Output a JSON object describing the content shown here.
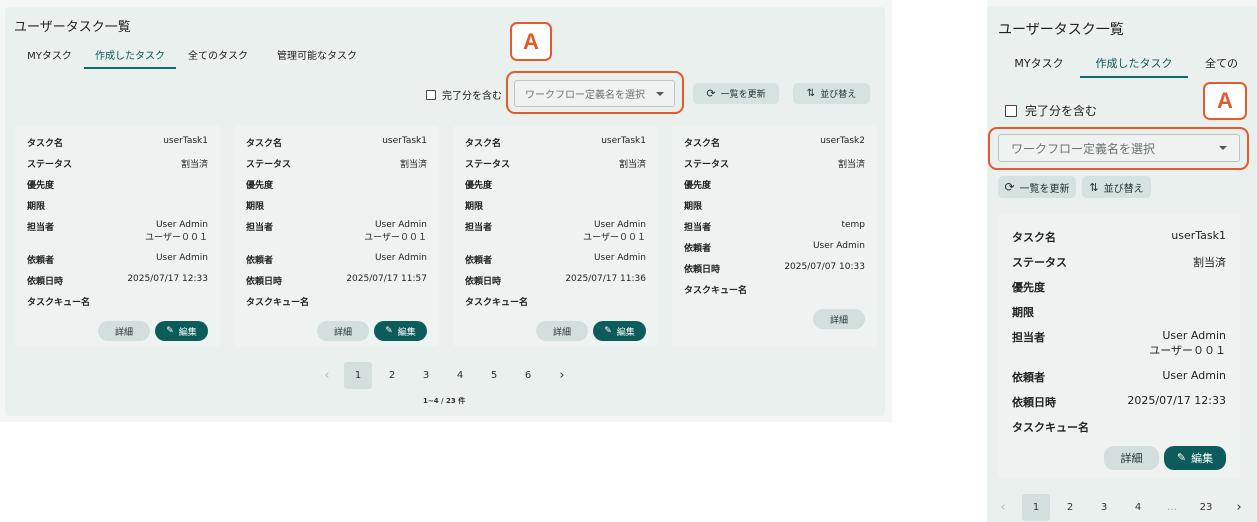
{
  "page": {
    "title": "ユーザータスク一覧",
    "tabs": [
      "MYタスク",
      "作成したタスク",
      "全てのタスク",
      "管理可能なタスク"
    ],
    "mobile_tabs": [
      "MYタスク",
      "作成したタスク",
      "全ての"
    ],
    "include_done_label": "完了分を含む",
    "workflow_placeholder": "ワークフロー定義名を選択",
    "refresh_label": "一覧を更新",
    "sort_label": "並び替え",
    "marker_label": "A",
    "detail_label": "詳細",
    "edit_label": "編集"
  },
  "field_labels": {
    "task_name": "タスク名",
    "status": "ステータス",
    "priority": "優先度",
    "due": "期限",
    "assignee": "担当者",
    "requester": "依頼者",
    "requested_at": "依頼日時",
    "task_queue": "タスクキュー名"
  },
  "cards": [
    {
      "task_name": "userTask1",
      "status": "割当済",
      "assignee": [
        "User Admin",
        "ユーザー００１"
      ],
      "requester": "User Admin",
      "requested_at": "2025/07/17 12:33",
      "editable": true
    },
    {
      "task_name": "userTask1",
      "status": "割当済",
      "assignee": [
        "User Admin",
        "ユーザー００１"
      ],
      "requester": "User Admin",
      "requested_at": "2025/07/17 11:57",
      "editable": true
    },
    {
      "task_name": "userTask1",
      "status": "割当済",
      "assignee": [
        "User Admin",
        "ユーザー００１"
      ],
      "requester": "User Admin",
      "requested_at": "2025/07/17 11:36",
      "editable": true
    },
    {
      "task_name": "userTask2",
      "status": "割当済",
      "assignee": [
        "temp"
      ],
      "requester": "User Admin",
      "requested_at": "2025/07/07 10:33",
      "editable": false
    }
  ],
  "pagination": {
    "prev": "‹",
    "next": "›",
    "pages": [
      "1",
      "2",
      "3",
      "4",
      "5",
      "6"
    ],
    "mobile_pages": [
      "1",
      "2",
      "3",
      "4",
      "…",
      "23"
    ],
    "current": "1",
    "count_text": "1~4 / 23 件"
  },
  "colors": {
    "accent": "#0d5c5c",
    "highlight": "#e45a2c",
    "panel": "#e9f0ee",
    "card": "#eef3f2"
  },
  "icons": {
    "refresh": "refresh-icon",
    "sort": "sort-icon",
    "edit": "pencil-icon",
    "dropdown": "chevron-down-icon",
    "checkbox": "checkbox-icon"
  }
}
